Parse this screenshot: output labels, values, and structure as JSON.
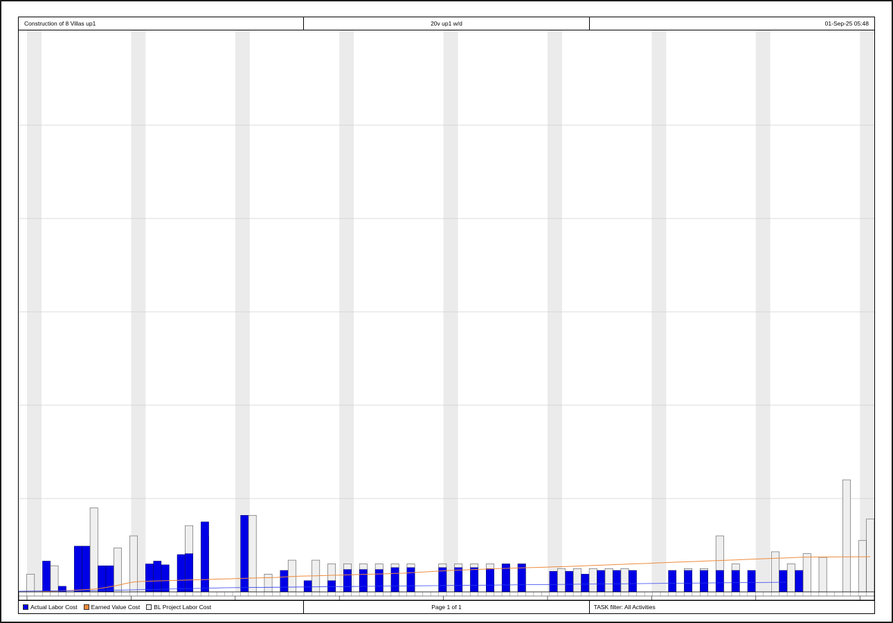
{
  "header": {
    "project": "Construction of 8 Villas up1",
    "layout": "20v up1 w/d",
    "date": "01-Sep-25 05:48"
  },
  "footer": {
    "page": "Page 1 of 1",
    "filter": "TASK filter: All Activities"
  },
  "colors": {
    "actual": "#0000e6",
    "earned": "#ee8a3a",
    "baseline": "#efefef",
    "weekend": "#ebebeb",
    "blue_line": "#2b3cf0"
  },
  "chart_data": {
    "type": "bar",
    "ylim": [
      0,
      5000
    ],
    "yticks": [
      1000,
      2000,
      3000,
      4000,
      5000
    ],
    "series": [
      {
        "name": "Actual Labor Cost",
        "values": [
          0,
          0,
          0,
          330,
          0,
          60,
          0,
          490,
          490,
          0,
          280,
          280,
          0,
          0,
          0,
          0,
          300,
          330,
          290,
          0,
          400,
          410,
          0,
          750,
          0,
          0,
          0,
          0,
          820,
          0,
          0,
          0,
          0,
          230,
          0,
          0,
          120,
          0,
          0,
          120,
          0,
          240,
          0,
          240,
          0,
          240,
          0,
          260,
          0,
          260,
          0,
          0,
          0,
          260,
          0,
          260,
          0,
          260,
          0,
          250,
          0,
          300,
          0,
          300,
          0,
          0,
          0,
          220,
          0,
          220,
          0,
          190,
          0,
          230,
          0,
          230,
          0,
          230,
          0,
          0,
          0,
          0,
          230,
          0,
          230,
          0,
          230,
          0,
          230,
          0,
          230,
          0,
          230,
          0,
          0,
          0,
          230,
          0,
          230,
          0,
          0,
          0,
          0,
          0,
          0,
          0,
          0,
          0
        ]
      },
      {
        "name": "Earned Value Cost",
        "values": [
          0,
          0,
          0,
          5,
          8,
          12,
          15,
          20,
          25,
          30,
          40,
          55,
          70,
          90,
          105,
          112,
          115,
          118,
          120,
          122,
          125,
          128,
          130,
          132,
          135,
          138,
          140,
          142,
          145,
          148,
          150,
          152,
          155,
          160,
          165,
          168,
          170,
          172,
          175,
          178,
          180,
          182,
          185,
          188,
          190,
          192,
          195,
          198,
          200,
          205,
          210,
          215,
          220,
          225,
          230,
          233,
          236,
          240,
          243,
          246,
          250,
          252,
          255,
          258,
          260,
          262,
          265,
          268,
          270,
          273,
          276,
          280,
          283,
          286,
          290,
          293,
          296,
          300,
          303,
          306,
          310,
          313,
          316,
          320,
          323,
          326,
          330,
          333,
          336,
          340,
          343,
          346,
          350,
          353,
          356,
          360,
          363,
          366,
          370,
          372,
          373,
          374,
          374,
          375,
          375,
          376,
          376,
          377
        ]
      },
      {
        "name": "BL Project Labor Cost",
        "values": [
          0,
          190,
          0,
          0,
          280,
          0,
          0,
          0,
          0,
          900,
          0,
          0,
          470,
          0,
          600,
          0,
          0,
          0,
          0,
          0,
          0,
          710,
          0,
          600,
          0,
          0,
          0,
          0,
          0,
          820,
          0,
          190,
          0,
          0,
          340,
          0,
          0,
          340,
          0,
          300,
          0,
          300,
          0,
          300,
          0,
          300,
          0,
          300,
          0,
          300,
          0,
          0,
          0,
          300,
          0,
          300,
          0,
          300,
          0,
          300,
          0,
          300,
          0,
          300,
          0,
          0,
          0,
          0,
          250,
          0,
          250,
          0,
          250,
          0,
          250,
          0,
          250,
          0,
          0,
          0,
          0,
          0,
          0,
          0,
          250,
          0,
          250,
          0,
          600,
          0,
          300,
          0,
          0,
          0,
          0,
          430,
          0,
          300,
          0,
          410,
          0,
          370,
          0,
          0,
          1200,
          0,
          550,
          780
        ]
      }
    ]
  }
}
